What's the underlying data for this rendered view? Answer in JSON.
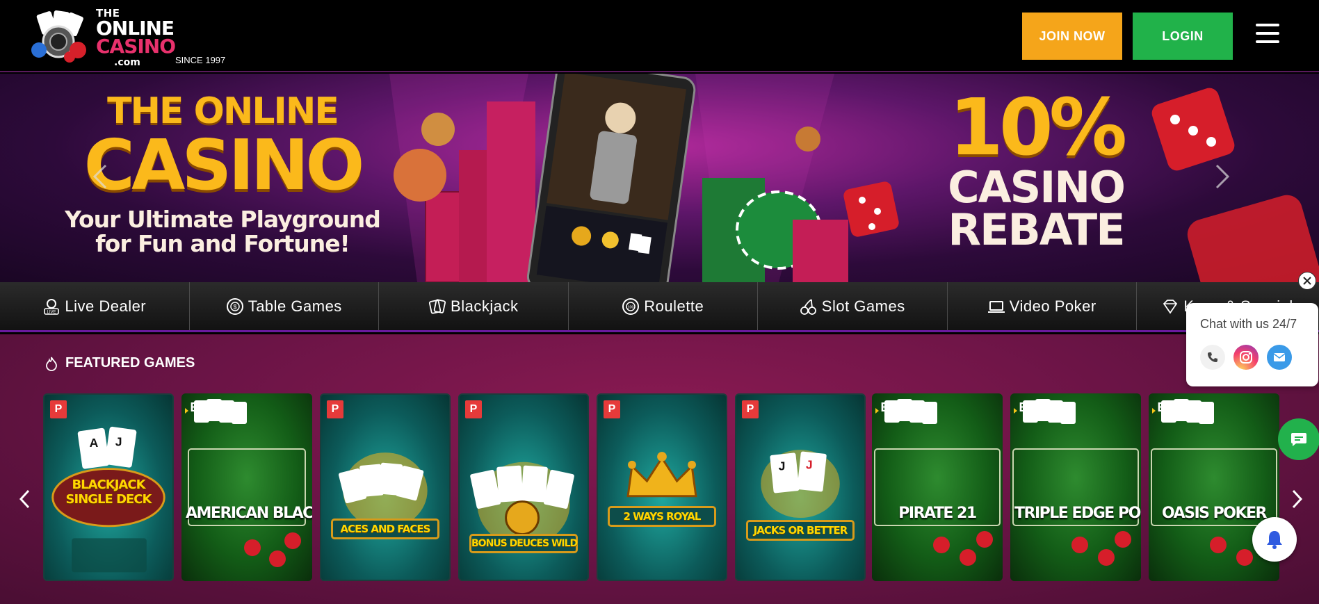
{
  "header": {
    "logo": {
      "line1": "THE",
      "line2": "ONLINE",
      "line3": "CASINO",
      "line4": ".com",
      "since": "SINCE 1997"
    },
    "join_label": "JOIN NOW",
    "login_label": "LOGIN"
  },
  "hero": {
    "title_line1": "THE ONLINE",
    "title_line2": "CASINO",
    "tagline_line1": "Your Ultimate Playground",
    "tagline_line2": "for Fun and Fortune!",
    "promo_percent": "10%",
    "promo_line1": "CASINO",
    "promo_line2": "REBATE"
  },
  "categories": [
    {
      "label": "Live Dealer",
      "icon": "live-dealer-icon"
    },
    {
      "label": "Table Games",
      "icon": "chip-icon"
    },
    {
      "label": "Blackjack",
      "icon": "cards-icon"
    },
    {
      "label": "Roulette",
      "icon": "roulette-icon"
    },
    {
      "label": "Slot Games",
      "icon": "cherry-icon"
    },
    {
      "label": "Video Poker",
      "icon": "laptop-icon"
    },
    {
      "label": "Keno & Specials",
      "icon": "diamond-icon"
    }
  ],
  "featured": {
    "title": "FEATURED GAMES",
    "games": [
      {
        "title": "BLACKJACK SINGLE DECK",
        "badge": "P",
        "style": "teal"
      },
      {
        "title": "AMERICAN BLACKJACK",
        "badge": "B",
        "style": "green"
      },
      {
        "title": "ACES AND FACES",
        "badge": "P",
        "style": "teal"
      },
      {
        "title": "BONUS DEUCES WILD",
        "badge": "P",
        "style": "teal"
      },
      {
        "title": "2 WAYS ROYAL",
        "badge": "P",
        "style": "teal"
      },
      {
        "title": "JACKS OR BETTER",
        "badge": "P",
        "style": "teal"
      },
      {
        "title": "PIRATE 21",
        "badge": "B",
        "style": "green"
      },
      {
        "title": "TRIPLE EDGE POKER",
        "badge": "B",
        "style": "green"
      },
      {
        "title": "OASIS POKER",
        "badge": "B",
        "style": "green"
      }
    ]
  },
  "chat": {
    "title": "Chat with us 24/7"
  },
  "colors": {
    "join": "#f5a51a",
    "login": "#21b24a",
    "gold": "#fbb91b",
    "accent": "#e8316c"
  }
}
